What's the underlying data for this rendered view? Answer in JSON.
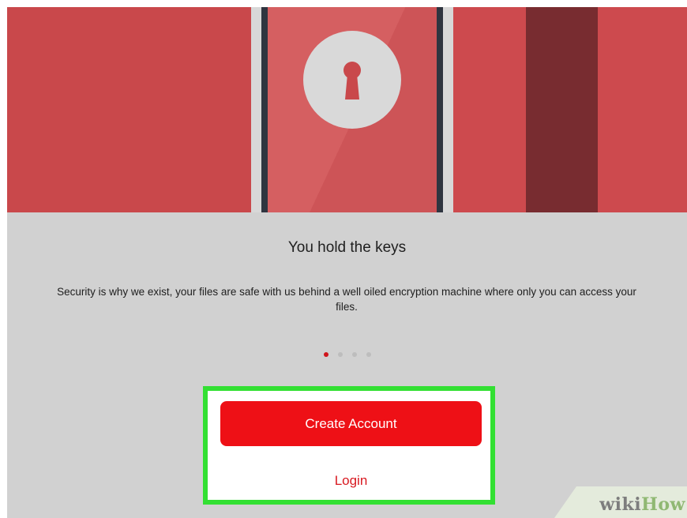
{
  "onboarding": {
    "title": "You hold the keys",
    "body": "Security is why we exist, your files are safe with us behind a well oiled encryption machine where only you can access your files.",
    "page_count": 4,
    "active_page": 1,
    "accent_color": "#ee1016"
  },
  "actions": {
    "create_account_label": "Create Account",
    "login_label": "Login"
  },
  "hero": {
    "icon": "keyhole-lock-icon"
  },
  "watermark": {
    "part1": "wiki",
    "part2": "How"
  }
}
